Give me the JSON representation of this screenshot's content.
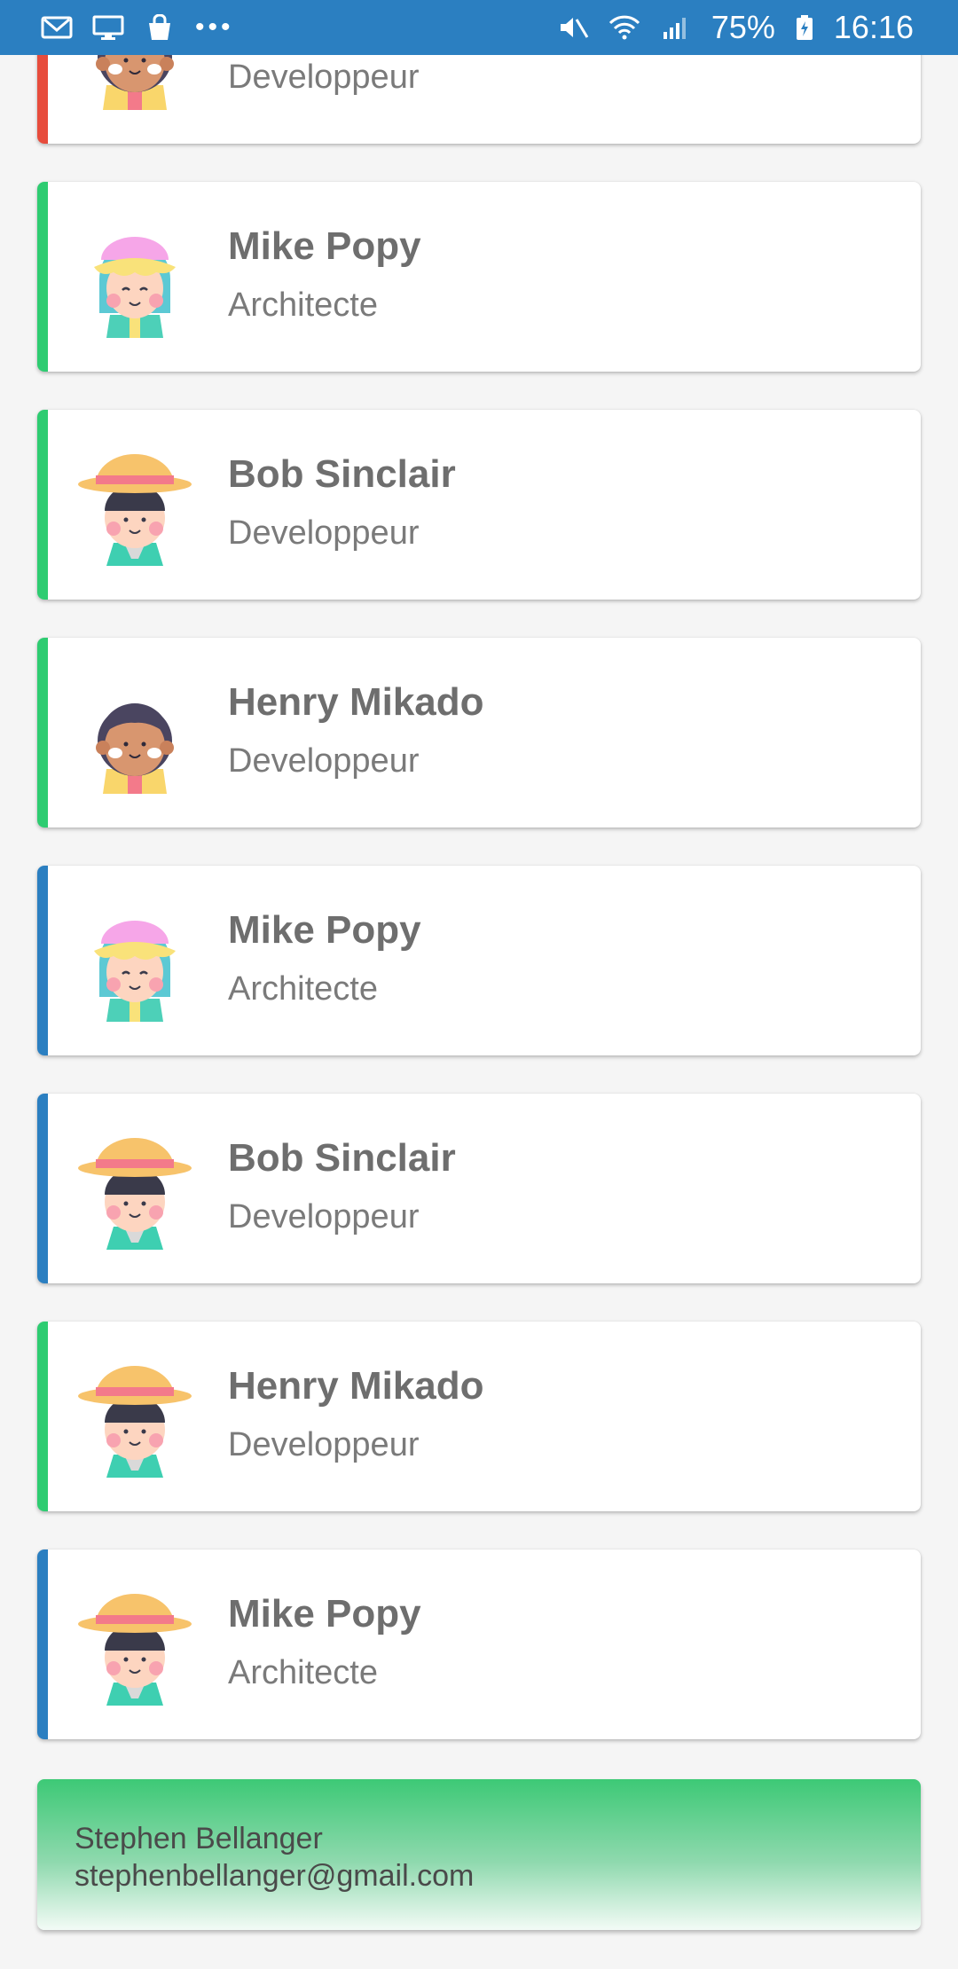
{
  "status_bar": {
    "battery": "75%",
    "time": "16:16",
    "left_icons": [
      "gmail-icon",
      "screen-icon",
      "bag-icon",
      "more-dots-icon"
    ],
    "right_icons": [
      "mute-icon",
      "wifi-icon",
      "signal-icon",
      "battery-icon"
    ]
  },
  "colors": {
    "status_bar": "#2b7fc1",
    "stripe_red": "#e74c3c",
    "stripe_green": "#2ecc71",
    "stripe_blue": "#2b7fc1"
  },
  "contacts": [
    {
      "name": "",
      "role": "Developpeur",
      "stripe": "red",
      "avatar": "brown-avatar-icon"
    },
    {
      "name": "Mike Popy",
      "role": "Architecte",
      "stripe": "green",
      "avatar": "pink-hair-avatar-icon"
    },
    {
      "name": "Bob Sinclair",
      "role": "Developpeur",
      "stripe": "green",
      "avatar": "straw-hat-avatar-icon"
    },
    {
      "name": "Henry Mikado",
      "role": "Developpeur",
      "stripe": "green",
      "avatar": "brown-avatar-icon"
    },
    {
      "name": "Mike Popy",
      "role": "Architecte",
      "stripe": "blue",
      "avatar": "pink-hair-avatar-icon"
    },
    {
      "name": "Bob Sinclair",
      "role": "Developpeur",
      "stripe": "blue",
      "avatar": "straw-hat-avatar-icon"
    },
    {
      "name": "Henry Mikado",
      "role": "Developpeur",
      "stripe": "green",
      "avatar": "straw-hat-avatar-icon"
    },
    {
      "name": "Mike Popy",
      "role": "Architecte",
      "stripe": "blue",
      "avatar": "straw-hat-avatar-icon"
    }
  ],
  "profile": {
    "name": "Stephen Bellanger",
    "email": "stephenbellanger@gmail.com"
  }
}
